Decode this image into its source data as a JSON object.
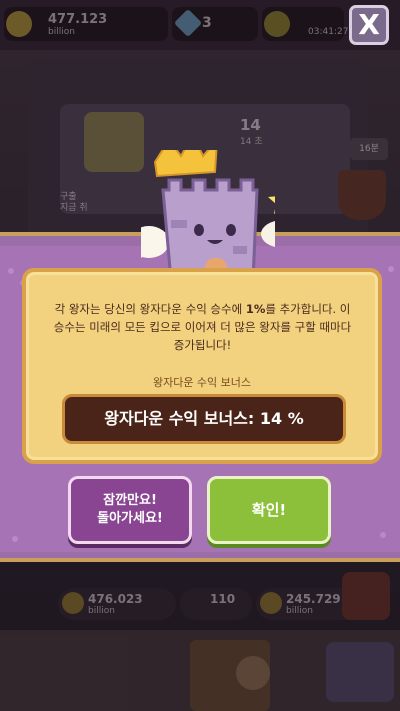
{
  "top_bar": {
    "gold_value": "477.123",
    "gold_unit": "billion",
    "gems": "3",
    "timer": "03:41:27",
    "close_label": "X"
  },
  "background": {
    "card_number": "14",
    "card_sub": "14 초",
    "left_text": "구출\n지금 취",
    "right_badge": "16분"
  },
  "modal": {
    "description_parts": [
      "각 왕자는 당신의 왕자다운 수익 승수에 ",
      "1%",
      "를 추가합니다. 이 승수는 미래의 모든 킵으로 이어져 더 많은 왕자를 구할 때마다 증가됩니다!"
    ],
    "bonus_label": "왕자다운 수익 보너스",
    "bonus_value": "왕자다운 수익 보너스: 14 %",
    "back_button_line1": "잠깐만요!",
    "back_button_line2": "돌아가세요!",
    "ok_button": "확인!"
  },
  "bottom_bar": {
    "left_value": "476.023",
    "left_unit": "billion",
    "mid_value": "110",
    "right_value": "245.729",
    "right_unit": "billion"
  },
  "colors": {
    "panel": "#f2d27e",
    "band": "#a673b4",
    "back_button": "#8a4592",
    "ok_button": "#8cbf3a",
    "bonus_box": "#4a2418"
  }
}
